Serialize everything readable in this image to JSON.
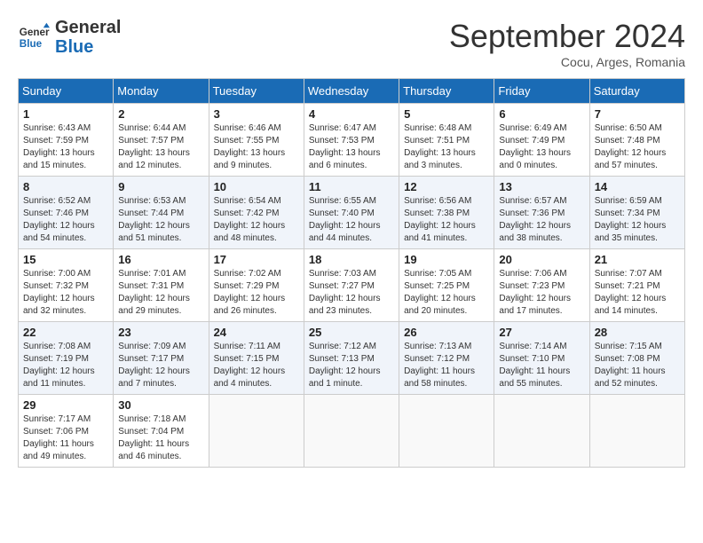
{
  "header": {
    "logo_general": "General",
    "logo_blue": "Blue",
    "month_title": "September 2024",
    "subtitle": "Cocu, Arges, Romania"
  },
  "weekdays": [
    "Sunday",
    "Monday",
    "Tuesday",
    "Wednesday",
    "Thursday",
    "Friday",
    "Saturday"
  ],
  "weeks": [
    [
      {
        "day": "1",
        "lines": [
          "Sunrise: 6:43 AM",
          "Sunset: 7:59 PM",
          "Daylight: 13 hours",
          "and 15 minutes."
        ]
      },
      {
        "day": "2",
        "lines": [
          "Sunrise: 6:44 AM",
          "Sunset: 7:57 PM",
          "Daylight: 13 hours",
          "and 12 minutes."
        ]
      },
      {
        "day": "3",
        "lines": [
          "Sunrise: 6:46 AM",
          "Sunset: 7:55 PM",
          "Daylight: 13 hours",
          "and 9 minutes."
        ]
      },
      {
        "day": "4",
        "lines": [
          "Sunrise: 6:47 AM",
          "Sunset: 7:53 PM",
          "Daylight: 13 hours",
          "and 6 minutes."
        ]
      },
      {
        "day": "5",
        "lines": [
          "Sunrise: 6:48 AM",
          "Sunset: 7:51 PM",
          "Daylight: 13 hours",
          "and 3 minutes."
        ]
      },
      {
        "day": "6",
        "lines": [
          "Sunrise: 6:49 AM",
          "Sunset: 7:49 PM",
          "Daylight: 13 hours",
          "and 0 minutes."
        ]
      },
      {
        "day": "7",
        "lines": [
          "Sunrise: 6:50 AM",
          "Sunset: 7:48 PM",
          "Daylight: 12 hours",
          "and 57 minutes."
        ]
      }
    ],
    [
      {
        "day": "8",
        "lines": [
          "Sunrise: 6:52 AM",
          "Sunset: 7:46 PM",
          "Daylight: 12 hours",
          "and 54 minutes."
        ]
      },
      {
        "day": "9",
        "lines": [
          "Sunrise: 6:53 AM",
          "Sunset: 7:44 PM",
          "Daylight: 12 hours",
          "and 51 minutes."
        ]
      },
      {
        "day": "10",
        "lines": [
          "Sunrise: 6:54 AM",
          "Sunset: 7:42 PM",
          "Daylight: 12 hours",
          "and 48 minutes."
        ]
      },
      {
        "day": "11",
        "lines": [
          "Sunrise: 6:55 AM",
          "Sunset: 7:40 PM",
          "Daylight: 12 hours",
          "and 44 minutes."
        ]
      },
      {
        "day": "12",
        "lines": [
          "Sunrise: 6:56 AM",
          "Sunset: 7:38 PM",
          "Daylight: 12 hours",
          "and 41 minutes."
        ]
      },
      {
        "day": "13",
        "lines": [
          "Sunrise: 6:57 AM",
          "Sunset: 7:36 PM",
          "Daylight: 12 hours",
          "and 38 minutes."
        ]
      },
      {
        "day": "14",
        "lines": [
          "Sunrise: 6:59 AM",
          "Sunset: 7:34 PM",
          "Daylight: 12 hours",
          "and 35 minutes."
        ]
      }
    ],
    [
      {
        "day": "15",
        "lines": [
          "Sunrise: 7:00 AM",
          "Sunset: 7:32 PM",
          "Daylight: 12 hours",
          "and 32 minutes."
        ]
      },
      {
        "day": "16",
        "lines": [
          "Sunrise: 7:01 AM",
          "Sunset: 7:31 PM",
          "Daylight: 12 hours",
          "and 29 minutes."
        ]
      },
      {
        "day": "17",
        "lines": [
          "Sunrise: 7:02 AM",
          "Sunset: 7:29 PM",
          "Daylight: 12 hours",
          "and 26 minutes."
        ]
      },
      {
        "day": "18",
        "lines": [
          "Sunrise: 7:03 AM",
          "Sunset: 7:27 PM",
          "Daylight: 12 hours",
          "and 23 minutes."
        ]
      },
      {
        "day": "19",
        "lines": [
          "Sunrise: 7:05 AM",
          "Sunset: 7:25 PM",
          "Daylight: 12 hours",
          "and 20 minutes."
        ]
      },
      {
        "day": "20",
        "lines": [
          "Sunrise: 7:06 AM",
          "Sunset: 7:23 PM",
          "Daylight: 12 hours",
          "and 17 minutes."
        ]
      },
      {
        "day": "21",
        "lines": [
          "Sunrise: 7:07 AM",
          "Sunset: 7:21 PM",
          "Daylight: 12 hours",
          "and 14 minutes."
        ]
      }
    ],
    [
      {
        "day": "22",
        "lines": [
          "Sunrise: 7:08 AM",
          "Sunset: 7:19 PM",
          "Daylight: 12 hours",
          "and 11 minutes."
        ]
      },
      {
        "day": "23",
        "lines": [
          "Sunrise: 7:09 AM",
          "Sunset: 7:17 PM",
          "Daylight: 12 hours",
          "and 7 minutes."
        ]
      },
      {
        "day": "24",
        "lines": [
          "Sunrise: 7:11 AM",
          "Sunset: 7:15 PM",
          "Daylight: 12 hours",
          "and 4 minutes."
        ]
      },
      {
        "day": "25",
        "lines": [
          "Sunrise: 7:12 AM",
          "Sunset: 7:13 PM",
          "Daylight: 12 hours",
          "and 1 minute."
        ]
      },
      {
        "day": "26",
        "lines": [
          "Sunrise: 7:13 AM",
          "Sunset: 7:12 PM",
          "Daylight: 11 hours",
          "and 58 minutes."
        ]
      },
      {
        "day": "27",
        "lines": [
          "Sunrise: 7:14 AM",
          "Sunset: 7:10 PM",
          "Daylight: 11 hours",
          "and 55 minutes."
        ]
      },
      {
        "day": "28",
        "lines": [
          "Sunrise: 7:15 AM",
          "Sunset: 7:08 PM",
          "Daylight: 11 hours",
          "and 52 minutes."
        ]
      }
    ],
    [
      {
        "day": "29",
        "lines": [
          "Sunrise: 7:17 AM",
          "Sunset: 7:06 PM",
          "Daylight: 11 hours",
          "and 49 minutes."
        ]
      },
      {
        "day": "30",
        "lines": [
          "Sunrise: 7:18 AM",
          "Sunset: 7:04 PM",
          "Daylight: 11 hours",
          "and 46 minutes."
        ]
      },
      {
        "day": "",
        "lines": []
      },
      {
        "day": "",
        "lines": []
      },
      {
        "day": "",
        "lines": []
      },
      {
        "day": "",
        "lines": []
      },
      {
        "day": "",
        "lines": []
      }
    ]
  ]
}
